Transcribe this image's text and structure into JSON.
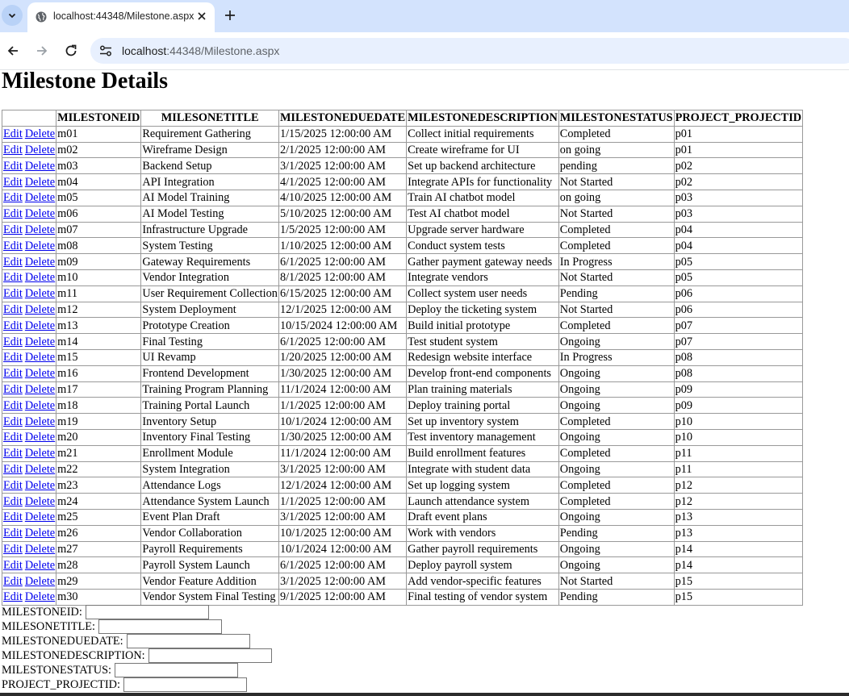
{
  "browser": {
    "tab_title": "localhost:44348/Milestone.aspx",
    "url_host": "localhost",
    "url_rest": ":44348/Milestone.aspx"
  },
  "page": {
    "heading": "Milestone Details"
  },
  "grid": {
    "columns": [
      "",
      "MILESTONEID",
      "MILESONETITLE",
      "MILESTONEDUEDATE",
      "MILESTONEDESCRIPTION",
      "MILESTONESTATUS",
      "PROJECT_PROJECTID"
    ],
    "edit_label": "Edit",
    "delete_label": "Delete",
    "rows": [
      [
        "m01",
        "Requirement Gathering",
        "1/15/2025 12:00:00 AM",
        "Collect initial requirements",
        "Completed",
        "p01"
      ],
      [
        "m02",
        "Wireframe Design",
        "2/1/2025 12:00:00 AM",
        "Create wireframe for UI",
        "on going",
        "p01"
      ],
      [
        "m03",
        "Backend Setup",
        "3/1/2025 12:00:00 AM",
        "Set up backend architecture",
        "pending",
        "p02"
      ],
      [
        "m04",
        "API Integration",
        "4/1/2025 12:00:00 AM",
        "Integrate APIs for functionality",
        "Not Started",
        "p02"
      ],
      [
        "m05",
        "AI Model Training",
        "4/10/2025 12:00:00 AM",
        "Train AI chatbot model",
        "on going",
        "p03"
      ],
      [
        "m06",
        "AI Model Testing",
        "5/10/2025 12:00:00 AM",
        "Test AI chatbot model",
        "Not Started",
        "p03"
      ],
      [
        "m07",
        "Infrastructure Upgrade",
        "1/5/2025 12:00:00 AM",
        "Upgrade server hardware",
        "Completed",
        "p04"
      ],
      [
        "m08",
        "System Testing",
        "1/10/2025 12:00:00 AM",
        "Conduct system tests",
        "Completed",
        "p04"
      ],
      [
        "m09",
        "Gateway Requirements",
        "6/1/2025 12:00:00 AM",
        "Gather payment gateway needs",
        "In Progress",
        "p05"
      ],
      [
        "m10",
        "Vendor Integration",
        "8/1/2025 12:00:00 AM",
        "Integrate vendors",
        "Not Started",
        "p05"
      ],
      [
        "m11",
        "User Requirement Collection",
        "6/15/2025 12:00:00 AM",
        "Collect system user needs",
        "Pending",
        "p06"
      ],
      [
        "m12",
        "System Deployment",
        "12/1/2025 12:00:00 AM",
        "Deploy the ticketing system",
        "Not Started",
        "p06"
      ],
      [
        "m13",
        "Prototype Creation",
        "10/15/2024 12:00:00 AM",
        "Build initial prototype",
        "Completed",
        "p07"
      ],
      [
        "m14",
        "Final Testing",
        "6/1/2025 12:00:00 AM",
        "Test student system",
        "Ongoing",
        "p07"
      ],
      [
        "m15",
        "UI Revamp",
        "1/20/2025 12:00:00 AM",
        "Redesign website interface",
        "In Progress",
        "p08"
      ],
      [
        "m16",
        "Frontend Development",
        "1/30/2025 12:00:00 AM",
        "Develop front-end components",
        "Ongoing",
        "p08"
      ],
      [
        "m17",
        "Training Program Planning",
        "11/1/2024 12:00:00 AM",
        "Plan training materials",
        "Ongoing",
        "p09"
      ],
      [
        "m18",
        "Training Portal Launch",
        "1/1/2025 12:00:00 AM",
        "Deploy training portal",
        "Ongoing",
        "p09"
      ],
      [
        "m19",
        "Inventory Setup",
        "10/1/2024 12:00:00 AM",
        "Set up inventory system",
        "Completed",
        "p10"
      ],
      [
        "m20",
        "Inventory Final Testing",
        "1/30/2025 12:00:00 AM",
        "Test inventory management",
        "Ongoing",
        "p10"
      ],
      [
        "m21",
        "Enrollment Module",
        "11/1/2024 12:00:00 AM",
        "Build enrollment features",
        "Completed",
        "p11"
      ],
      [
        "m22",
        "System Integration",
        "3/1/2025 12:00:00 AM",
        "Integrate with student data",
        "Ongoing",
        "p11"
      ],
      [
        "m23",
        "Attendance Logs",
        "12/1/2024 12:00:00 AM",
        "Set up logging system",
        "Completed",
        "p12"
      ],
      [
        "m24",
        "Attendance System Launch",
        "1/1/2025 12:00:00 AM",
        "Launch attendance system",
        "Completed",
        "p12"
      ],
      [
        "m25",
        "Event Plan Draft",
        "3/1/2025 12:00:00 AM",
        "Draft event plans",
        "Ongoing",
        "p13"
      ],
      [
        "m26",
        "Vendor Collaboration",
        "10/1/2025 12:00:00 AM",
        "Work with vendors",
        "Pending",
        "p13"
      ],
      [
        "m27",
        "Payroll Requirements",
        "10/1/2024 12:00:00 AM",
        "Gather payroll requirements",
        "Ongoing",
        "p14"
      ],
      [
        "m28",
        "Payroll System Launch",
        "6/1/2025 12:00:00 AM",
        "Deploy payroll system",
        "Ongoing",
        "p14"
      ],
      [
        "m29",
        "Vendor Feature Addition",
        "3/1/2025 12:00:00 AM",
        "Add vendor-specific features",
        "Not Started",
        "p15"
      ],
      [
        "m30",
        "Vendor System Final Testing",
        "9/1/2025 12:00:00 AM",
        "Final testing of vendor system",
        "Pending",
        "p15"
      ]
    ]
  },
  "form": {
    "fields": [
      {
        "label": "MILESTONEID:",
        "value": ""
      },
      {
        "label": "MILESONETITLE:",
        "value": ""
      },
      {
        "label": "MILESTONEDUEDATE:",
        "value": ""
      },
      {
        "label": "MILESTONEDESCRIPTION:",
        "value": ""
      },
      {
        "label": "MILESTONESTATUS:",
        "value": ""
      },
      {
        "label": "PROJECT_PROJECTID:",
        "value": ""
      }
    ]
  },
  "icons": {
    "tab_menu": "chevron-down-icon",
    "favicon": "globe-icon",
    "close": "close-icon",
    "new_tab": "plus-icon",
    "back": "back-arrow-icon",
    "forward": "forward-arrow-icon",
    "reload": "reload-icon",
    "site_info": "site-settings-icon"
  }
}
